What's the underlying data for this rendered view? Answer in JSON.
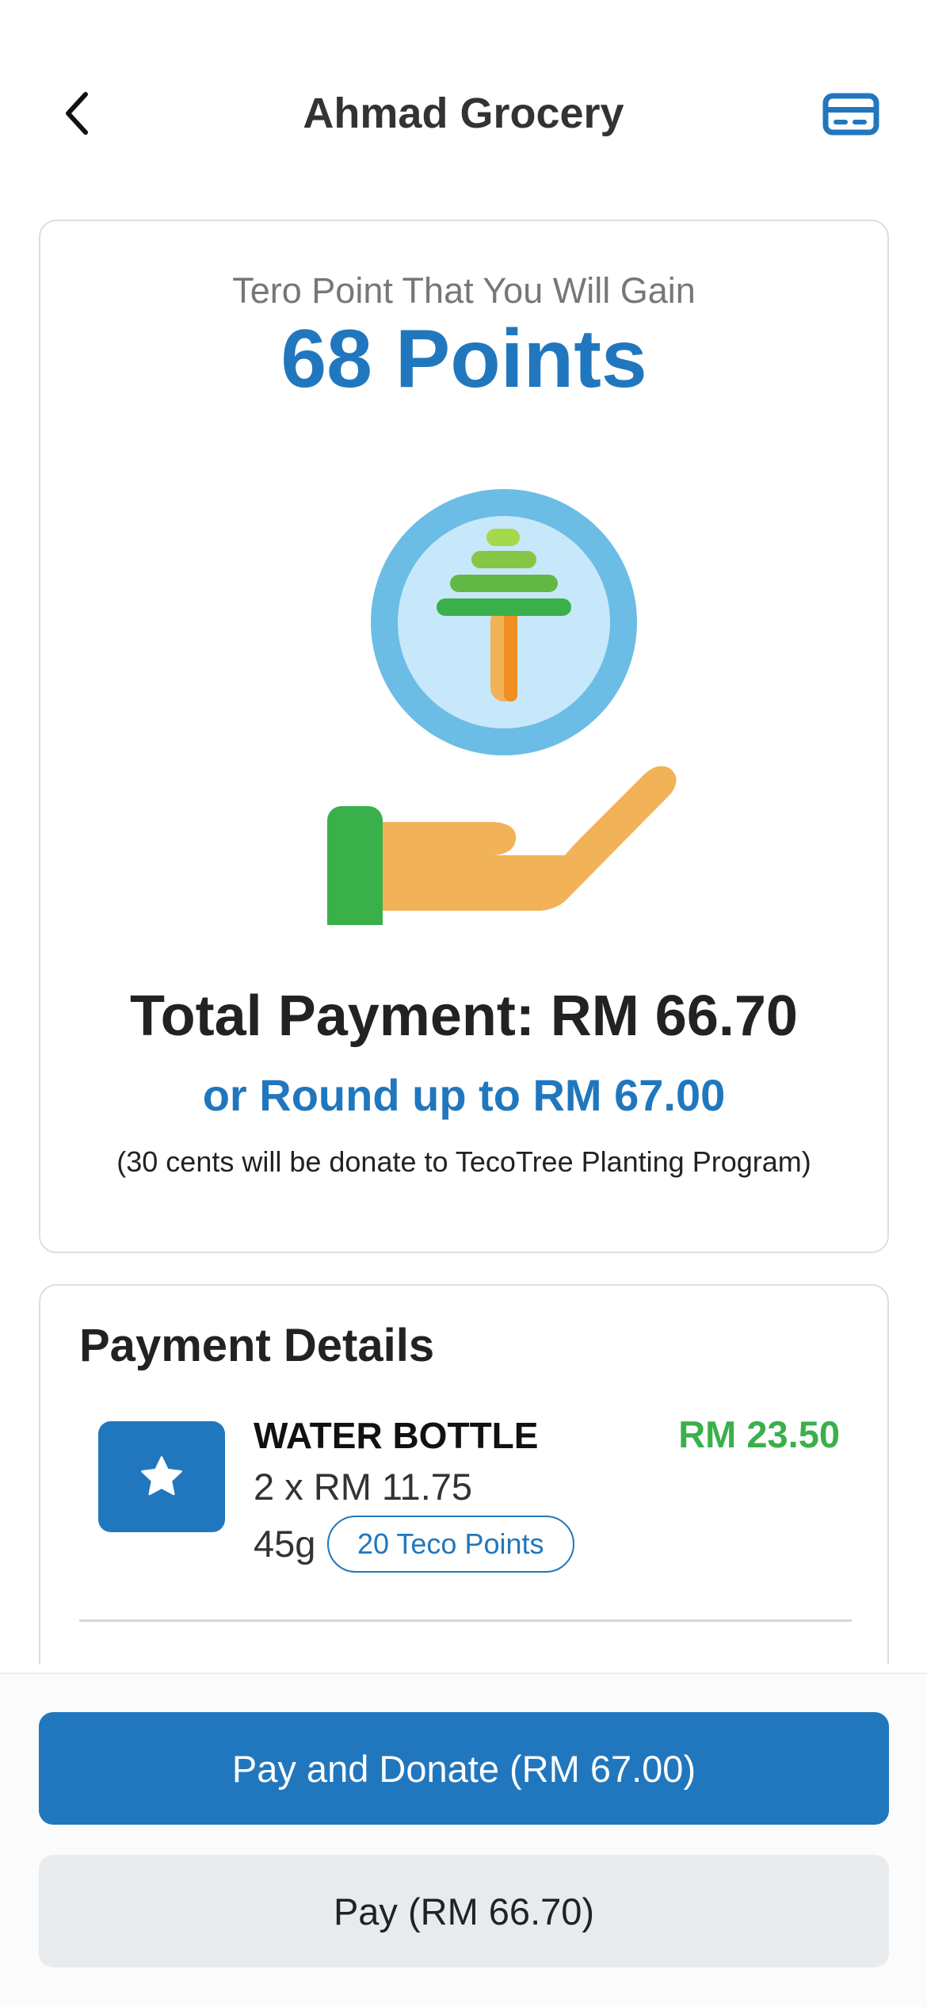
{
  "header": {
    "title": "Ahmad Grocery",
    "back_icon": "chevron-left-icon",
    "card_icon": "credit-card-icon"
  },
  "points_card": {
    "gain_label": "Tero Point That You Will Gain",
    "points_value": "68 Points",
    "illustration_icon": "hand-holding-tree-coin-icon",
    "total_payment": "Total Payment: RM 66.70",
    "roundup": "or Round up to RM 67.00",
    "donate_note": "(30 cents will be donate to TecoTree Planting Program)"
  },
  "payment_details": {
    "title": "Payment Details",
    "items": [
      {
        "icon": "star-icon",
        "name": "WATER BOTTLE",
        "price": "RM 23.50",
        "qty": "2 x RM 11.75",
        "weight": "45g",
        "points_badge": "20 Teco Points"
      }
    ]
  },
  "actions": {
    "pay_donate_label": "Pay and Donate (RM 67.00)",
    "pay_label": "Pay (RM 66.70)"
  },
  "colors": {
    "accent": "#2177bd",
    "price_green": "#3ab04a",
    "secondary_button": "#e8ebee"
  }
}
